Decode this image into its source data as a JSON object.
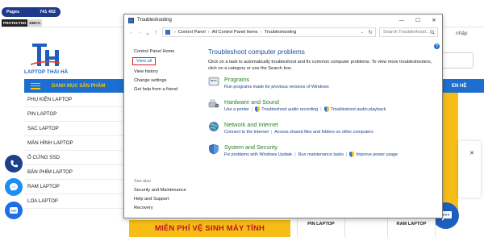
{
  "site": {
    "pages_label": "Pages",
    "pages_count": "741 402",
    "dmca_left": "PROTECTED",
    "dmca_right": "DMCA",
    "login_partial": "nhập",
    "logo_text": "LAPTOP THÁI HÀ",
    "menu_label": "DANH MỤC SẢN PHẨM",
    "menu_right_partial": "EN HỆ",
    "categories": [
      "PHỤ KIỆN LAPTOP",
      "PIN LAPTOP",
      "SẠC LAPTOP",
      "MÀN HÌNH LAPTOP",
      "Ổ CỨNG SSD",
      "BÀN PHÍM LAPTOP",
      "RAM LAPTOP",
      "LOA LAPTOP"
    ],
    "promo_banner": "MIỄN PHÍ VỆ SINH MÁY TÍNH",
    "product_tiles": [
      "PIN LAPTOP",
      "RAM LAPTOP"
    ],
    "popup_close": "✕"
  },
  "window": {
    "title": "Troubleshooting",
    "controls": {
      "minimize": "—",
      "maximize": "☐",
      "close": "✕"
    },
    "breadcrumb": [
      "Control Panel",
      "All Control Panel Items",
      "Troubleshooting"
    ],
    "search_placeholder": "Search Troubleshooti...",
    "left_pane": {
      "home": "Control Panel Home",
      "view_all": "View all",
      "view_history": "View history",
      "change_settings": "Change settings",
      "get_help": "Get help from a friend"
    },
    "see_also": {
      "title": "See also",
      "items": [
        "Security and Maintenance",
        "Help and Support",
        "Recovery"
      ]
    },
    "main": {
      "title": "Troubleshoot computer problems",
      "description": "Click on a task to automatically troubleshoot and fix common computer problems. To view more troubleshooters, click on a category or use the Search box.",
      "categories": [
        {
          "title": "Programs",
          "links": [
            "Run programs made for previous versions of Windows"
          ]
        },
        {
          "title": "Hardware and Sound",
          "links": [
            "Use a printer",
            "Troubleshoot audio recording",
            "Troubleshoot audio playback"
          ]
        },
        {
          "title": "Network and Internet",
          "links": [
            "Connect to the Internet",
            "Access shared files and folders on other computers"
          ]
        },
        {
          "title": "System and Security",
          "links": [
            "Fix problems with Windows Update",
            "Run maintenance tasks",
            "Improve power usage"
          ]
        }
      ]
    }
  },
  "colors": {
    "link": "#1a3e8a",
    "category_title": "#2a7f2a",
    "panel_title": "#1e4ea3",
    "site_blue": "#1d6fcf",
    "site_yellow": "#f6bd17",
    "highlight_red": "#d62020"
  }
}
